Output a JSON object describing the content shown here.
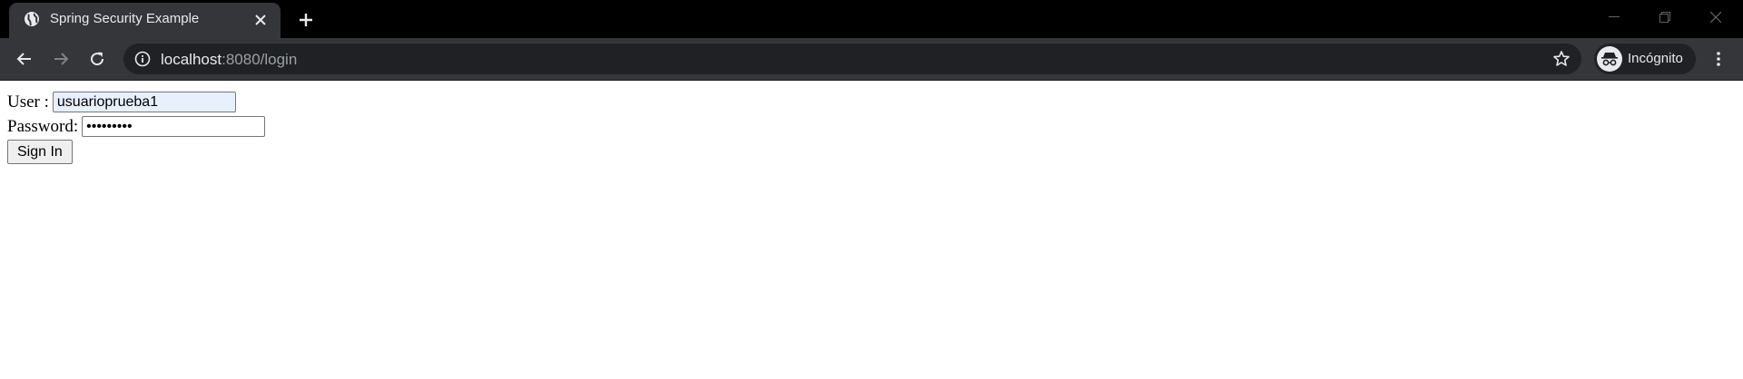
{
  "browser": {
    "tab": {
      "title": "Spring Security Example",
      "favicon": "globe-icon"
    },
    "url": {
      "host": "localhost",
      "rest": ":8080/login"
    },
    "profile_label": "Incógnito",
    "colors": {
      "titlebar": "#000000",
      "toolbar": "#35363a",
      "omnibox": "#202124",
      "text": "#e8eaed",
      "text_dim": "#9aa0a6"
    }
  },
  "form": {
    "user_label": "User :",
    "user_value": "usuarioprueba1",
    "password_label": "Password:",
    "password_value": "•••••••••",
    "submit_label": "Sign In",
    "autofill_color": "#e8f0fe"
  }
}
